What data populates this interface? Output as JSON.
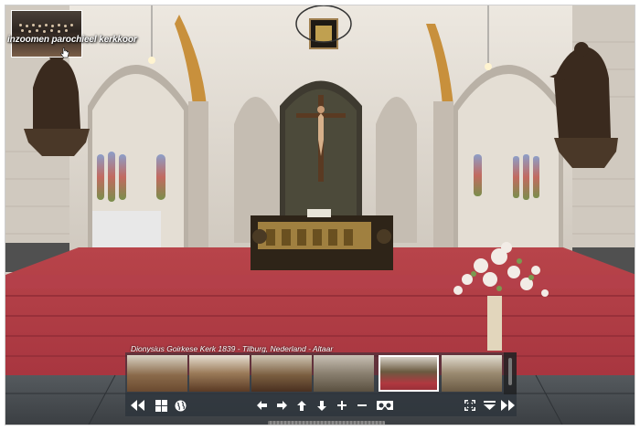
{
  "viewer": {
    "hotspot_caption": "inzoomen parochieel kerkkoor",
    "tour_title": "Dionysius Goirkese Kerk 1839 - Tilburg, Nederland - Altaar",
    "thumbnails": [
      {
        "name": "nave-view",
        "active": false
      },
      {
        "name": "pews-view",
        "active": false
      },
      {
        "name": "chancel-view",
        "active": false
      },
      {
        "name": "side-aisle-view",
        "active": false
      },
      {
        "name": "altar-view",
        "active": true
      },
      {
        "name": "choir-view",
        "active": false
      }
    ],
    "toolbar": {
      "left": [
        "prev-icon",
        "grid-icon",
        "globe-icon"
      ],
      "center": [
        "arrow-left-icon",
        "arrow-right-icon",
        "arrow-up-icon",
        "arrow-down-icon",
        "zoom-in-icon",
        "zoom-out-icon",
        "vr-headset-icon"
      ],
      "right": [
        "fullscreen-icon",
        "hide-bar-icon",
        "next-icon"
      ]
    }
  },
  "colors": {
    "carpet": "#b03840",
    "stone": "#d9d4cc",
    "toolbar": "#2d343c",
    "gold": "#c8903c"
  }
}
